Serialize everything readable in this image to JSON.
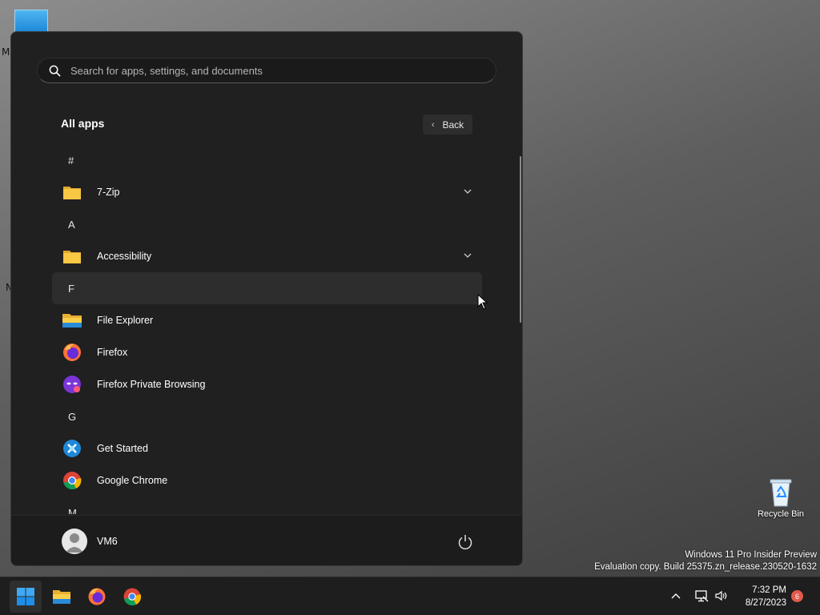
{
  "desktop": {
    "label_m": "M",
    "label_n": "N",
    "recycle_bin_label": "Recycle Bin",
    "watermark_line1": "Windows 11 Pro Insider Preview",
    "watermark_line2": "Evaluation copy. Build 25375.zn_release.230520-1632"
  },
  "start_menu": {
    "search_placeholder": "Search for apps, settings, and documents",
    "all_apps_title": "All apps",
    "back_label": "Back",
    "groups": [
      {
        "letter": "#",
        "apps": [
          {
            "name": "7-Zip",
            "icon": "folder-icon",
            "expandable": true
          }
        ]
      },
      {
        "letter": "A",
        "apps": [
          {
            "name": "Accessibility",
            "icon": "folder-icon",
            "expandable": true
          }
        ]
      },
      {
        "letter": "F",
        "apps": [
          {
            "name": "File Explorer",
            "icon": "file-explorer-icon"
          },
          {
            "name": "Firefox",
            "icon": "firefox-icon"
          },
          {
            "name": "Firefox Private Browsing",
            "icon": "firefox-private-icon"
          }
        ]
      },
      {
        "letter": "G",
        "apps": [
          {
            "name": "Get Started",
            "icon": "get-started-icon"
          },
          {
            "name": "Google Chrome",
            "icon": "chrome-icon"
          }
        ]
      },
      {
        "letter": "M",
        "apps": []
      }
    ],
    "user_name": "VM6"
  },
  "taskbar": {
    "apps": [
      "start-icon",
      "file-explorer-icon",
      "firefox-icon",
      "chrome-icon"
    ],
    "time": "7:32 PM",
    "date": "8/27/2023",
    "notification_count": "6"
  },
  "colors": {
    "menu_bg": "#202020",
    "taskbar_bg": "#1e1e1e",
    "accent": "#0078d4",
    "badge": "#e25b4b"
  }
}
